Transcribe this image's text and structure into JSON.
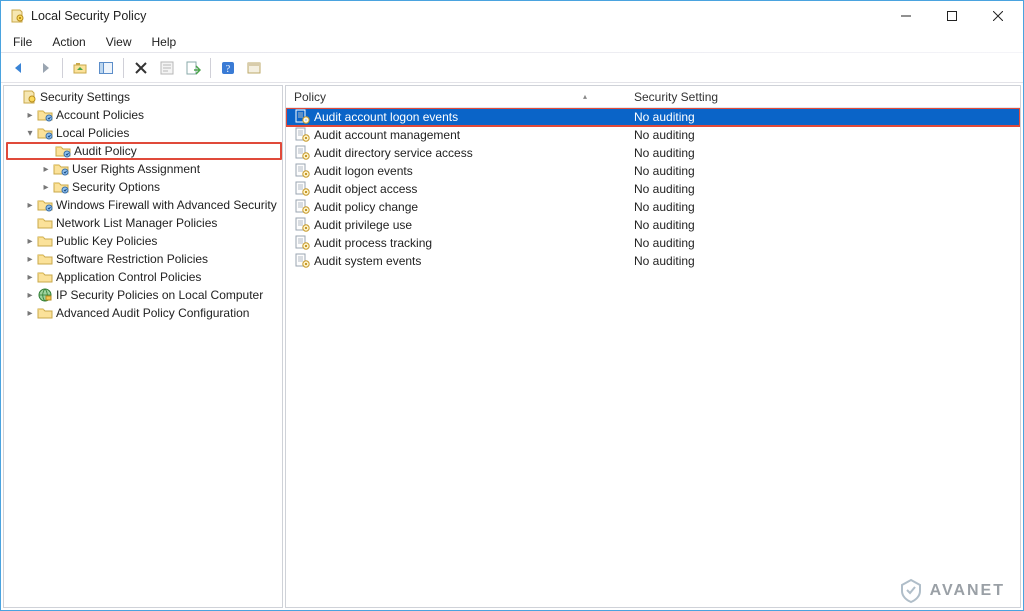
{
  "window": {
    "title": "Local Security Policy"
  },
  "menus": {
    "file": "File",
    "action": "Action",
    "view": "View",
    "help": "Help"
  },
  "tree": {
    "root": "Security Settings",
    "items": [
      {
        "label": "Account Policies",
        "indent": 1,
        "expander": ">",
        "icon": "folder"
      },
      {
        "label": "Local Policies",
        "indent": 1,
        "expander": "v",
        "icon": "folder"
      },
      {
        "label": "Audit Policy",
        "indent": 2,
        "expander": "",
        "icon": "folder",
        "highlight": true
      },
      {
        "label": "User Rights Assignment",
        "indent": 2,
        "expander": ">",
        "icon": "folder"
      },
      {
        "label": "Security Options",
        "indent": 2,
        "expander": ">",
        "icon": "folder"
      },
      {
        "label": "Windows Firewall with Advanced Security",
        "indent": 1,
        "expander": ">",
        "icon": "folder"
      },
      {
        "label": "Network List Manager Policies",
        "indent": 1,
        "expander": "",
        "icon": "folder-plain"
      },
      {
        "label": "Public Key Policies",
        "indent": 1,
        "expander": ">",
        "icon": "folder-plain"
      },
      {
        "label": "Software Restriction Policies",
        "indent": 1,
        "expander": ">",
        "icon": "folder-plain"
      },
      {
        "label": "Application Control Policies",
        "indent": 1,
        "expander": ">",
        "icon": "folder-plain"
      },
      {
        "label": "IP Security Policies on Local Computer",
        "indent": 1,
        "expander": ">",
        "icon": "ipsec"
      },
      {
        "label": "Advanced Audit Policy Configuration",
        "indent": 1,
        "expander": ">",
        "icon": "folder-plain"
      }
    ]
  },
  "list": {
    "columns": {
      "policy": "Policy",
      "setting": "Security Setting"
    },
    "rows": [
      {
        "policy": "Audit account logon events",
        "setting": "No auditing",
        "selected": true,
        "highlight": true
      },
      {
        "policy": "Audit account management",
        "setting": "No auditing"
      },
      {
        "policy": "Audit directory service access",
        "setting": "No auditing"
      },
      {
        "policy": "Audit logon events",
        "setting": "No auditing"
      },
      {
        "policy": "Audit object access",
        "setting": "No auditing"
      },
      {
        "policy": "Audit policy change",
        "setting": "No auditing"
      },
      {
        "policy": "Audit privilege use",
        "setting": "No auditing"
      },
      {
        "policy": "Audit process tracking",
        "setting": "No auditing"
      },
      {
        "policy": "Audit system events",
        "setting": "No auditing"
      }
    ]
  },
  "watermark": {
    "text": "AVANET"
  }
}
